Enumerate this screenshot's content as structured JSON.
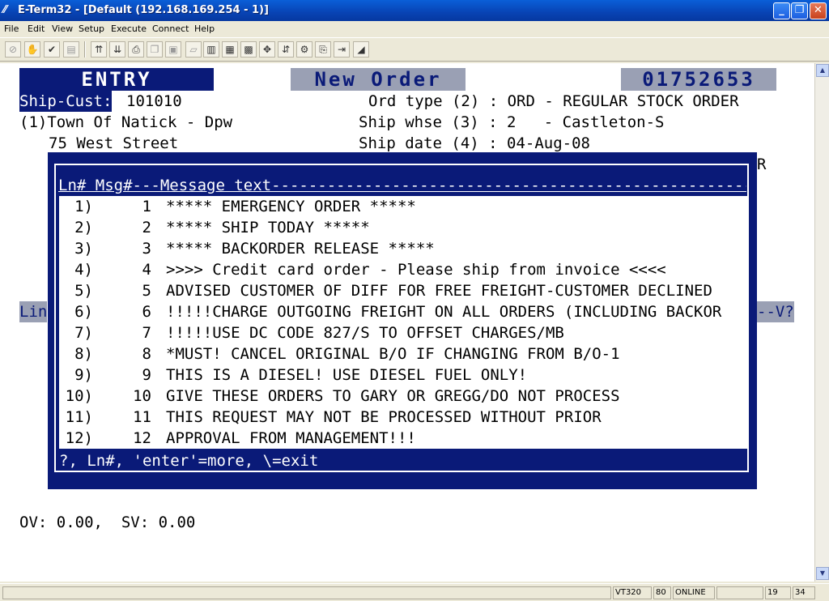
{
  "window": {
    "title": "E-Term32 - [Default (192.168.169.254 - 1)]",
    "minimize": "_",
    "restore": "❐",
    "close": "✕"
  },
  "menu": [
    "File",
    "Edit",
    "View",
    "Setup",
    "Execute",
    "Connect",
    "Help"
  ],
  "toolbar": {
    "icons": [
      "disconnect-icon",
      "hand-icon",
      "connect-icon",
      "print-setup-icon",
      "upload-icon",
      "download-icon",
      "print-icon",
      "copy-icon",
      "paste-icon",
      "edit-icon",
      "capture-icon",
      "log-icon",
      "keypad-icon",
      "settings-icon",
      "transfer-icon",
      "macro-icon",
      "script-icon",
      "exit-icon",
      "status-icon"
    ]
  },
  "terminal": {
    "entry_label": "ENTRY",
    "new_order_label": "New Order",
    "order_number": "01752653",
    "ship_cust_label": "Ship-Cust:",
    "ship_cust_value": "101010",
    "customer_name": "(1)Town Of Natick - Dpw",
    "address": "75 West Street",
    "ord_type": "Ord type (2) : ORD - REGULAR STOCK ORDER",
    "ship_whse": "Ship whse (3) : 2   - Castleton-S",
    "ship_date": "Ship date (4) : 04-Aug-08",
    "right_fragment": "R",
    "lin_fragment": "Lin",
    "v_fragment": "--V?",
    "ov_sv": "OV: 0.00,  SV: 0.00"
  },
  "popup": {
    "header": "Ln# Msg#---Message text-------------------------------------------------------",
    "rows": [
      {
        "ln": "1)",
        "msg": "1",
        "text": "***** EMERGENCY ORDER *****"
      },
      {
        "ln": "2)",
        "msg": "2",
        "text": "***** SHIP TODAY *****"
      },
      {
        "ln": "3)",
        "msg": "3",
        "text": "***** BACKORDER RELEASE *****"
      },
      {
        "ln": "4)",
        "msg": "4",
        "text": ">>>> Credit card order - Please ship from invoice <<<<"
      },
      {
        "ln": "5)",
        "msg": "5",
        "text": "ADVISED CUSTOMER OF DIFF FOR FREE FREIGHT-CUSTOMER DECLINED"
      },
      {
        "ln": "6)",
        "msg": "6",
        "text": "!!!!!CHARGE OUTGOING FREIGHT ON ALL ORDERS (INCLUDING BACKOR"
      },
      {
        "ln": "7)",
        "msg": "7",
        "text": "!!!!!USE DC CODE 827/S TO OFFSET CHARGES/MB"
      },
      {
        "ln": "8)",
        "msg": "8",
        "text": "*MUST! CANCEL ORIGINAL B/O IF CHANGING FROM B/O-1"
      },
      {
        "ln": "9)",
        "msg": "9",
        "text": "THIS IS A DIESEL! USE DIESEL FUEL ONLY!"
      },
      {
        "ln": "10)",
        "msg": "10",
        "text": "GIVE THESE ORDERS TO GARY OR GREGG/DO NOT PROCESS"
      },
      {
        "ln": "11)",
        "msg": "11",
        "text": "THIS REQUEST MAY NOT BE PROCESSED WITHOUT PRIOR"
      },
      {
        "ln": "12)",
        "msg": "12",
        "text": "APPROVAL FROM MANAGEMENT!!!"
      }
    ],
    "prompt": "?, Ln#, 'enter'=more, \\=exit"
  },
  "status": {
    "emulation": "VT320",
    "columns": "80",
    "state": "ONLINE",
    "row": "19",
    "col": "34"
  }
}
